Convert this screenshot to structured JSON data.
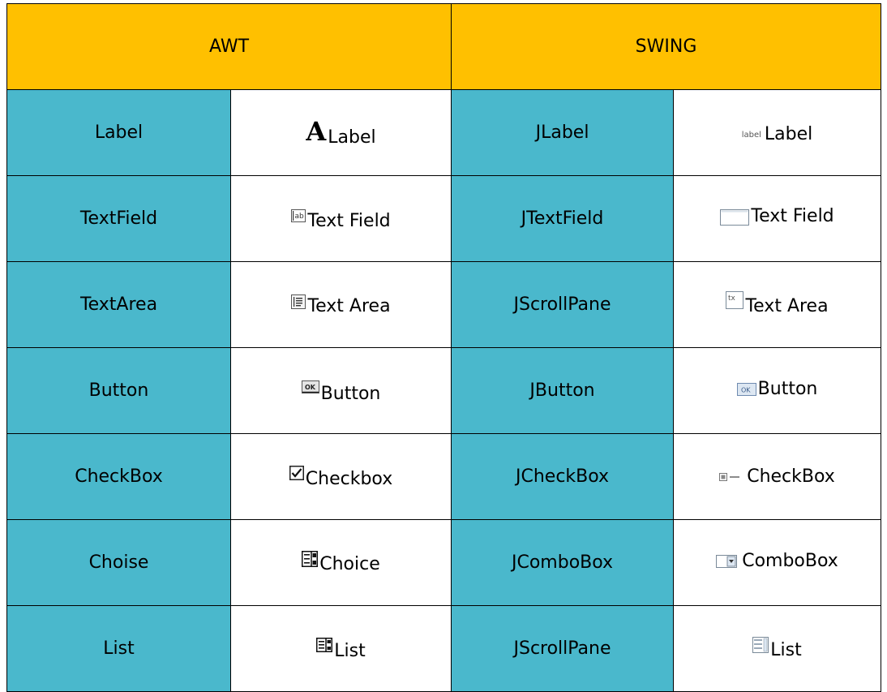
{
  "header": {
    "awt": "AWT",
    "swing": "SWING"
  },
  "colors": {
    "header_bg": "#ffc000",
    "name_bg": "#4ab8cc",
    "preview_bg": "#ffffff",
    "border": "#000000"
  },
  "rows": [
    {
      "awt_name": "Label",
      "awt_preview": "Label",
      "awt_icon": "letter-a-icon",
      "swing_name": "JLabel",
      "swing_preview": "Label",
      "swing_icon": "label-icon",
      "swing_icon_text": "label"
    },
    {
      "awt_name": "TextField",
      "awt_preview": "Text Field",
      "awt_icon": "textfield-ab-icon",
      "awt_icon_text": "ab",
      "swing_name": "JTextField",
      "swing_preview": "Text Field",
      "swing_icon": "textfield-box-icon"
    },
    {
      "awt_name": "TextArea",
      "awt_preview": "Text Area",
      "awt_icon": "textarea-icon",
      "swing_name": "JScrollPane",
      "swing_preview": "Text Area",
      "swing_icon": "textarea-tx-icon",
      "swing_icon_text": "tx"
    },
    {
      "awt_name": "Button",
      "awt_preview": "Button",
      "awt_icon": "ok-button-icon",
      "awt_icon_text": "OK",
      "swing_name": "JButton",
      "swing_preview": "Button",
      "swing_icon": "ok-button-swing-icon",
      "swing_icon_text": "OK"
    },
    {
      "awt_name": "CheckBox",
      "awt_preview": "Checkbox",
      "awt_icon": "checkbox-checked-icon",
      "swing_name": "JCheckBox",
      "swing_preview": "CheckBox",
      "swing_icon": "checkbox-swing-icon"
    },
    {
      "awt_name": "Choise",
      "awt_preview": "Choice",
      "awt_icon": "choice-icon",
      "swing_name": "JComboBox",
      "swing_preview": "ComboBox",
      "swing_icon": "combobox-icon"
    },
    {
      "awt_name": "List",
      "awt_preview": "List",
      "awt_icon": "list-icon",
      "swing_name": "JScrollPane",
      "swing_preview": "List",
      "swing_icon": "list-swing-icon"
    }
  ]
}
